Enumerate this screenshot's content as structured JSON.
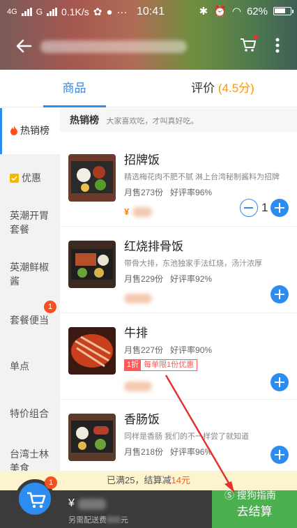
{
  "status": {
    "net1": "4G",
    "net2": "G",
    "speed": "0.1K/s",
    "time": "10:41",
    "battery": "62%"
  },
  "tabs": {
    "goods": "商品",
    "review": "评价",
    "score": "(4.5分)"
  },
  "sidebar": [
    {
      "label": "热销榜",
      "icon": "fire-icon",
      "active": true
    },
    {
      "label": "优惠",
      "icon": "tag-icon"
    },
    {
      "label": "英潮开胃套餐"
    },
    {
      "label": "英潮鲜椒酱"
    },
    {
      "label": "套餐便当",
      "badge": "1"
    },
    {
      "label": "单点"
    },
    {
      "label": "特价组合"
    },
    {
      "label": "台湾士林美食"
    }
  ],
  "section": {
    "title": "热销榜",
    "desc": "大家喜欢吃，才叫真好吃。"
  },
  "items": [
    {
      "name": "招牌饭",
      "desc": "精选梅花肉不肥不腻 淋上台湾秘制酱料为招牌",
      "sold": "月售273份",
      "rating": "好评率96%",
      "price_symbol": "¥",
      "qty": "1"
    },
    {
      "name": "红烧排骨饭",
      "desc": "带骨大排，东池独家手法红烧，汤汁浓厚",
      "sold": "月售229份",
      "rating": "好评率92%"
    },
    {
      "name": "牛排",
      "desc": "",
      "sold": "月售227份",
      "rating": "好评率90%",
      "promo_off": "1折",
      "promo_limit": "每单限1份优惠"
    },
    {
      "name": "香肠饭",
      "desc": "同样是香肠 我们的不一样尝了就知道",
      "sold": "月售218份",
      "rating": "好评率96%"
    }
  ],
  "discount": {
    "prefix": "已满25，结算减",
    "amount": "14元"
  },
  "cart": {
    "badge": "1",
    "total_symbol": "¥",
    "delivery": "另需配送费",
    "delivery_suffix": "元",
    "checkout": "去结算"
  },
  "watermark": "搜狗指南",
  "colors": {
    "accent": "#2d8cf0",
    "checkout": "#4caf50",
    "orange": "#ff9800",
    "promo": "#ff5a5a"
  }
}
